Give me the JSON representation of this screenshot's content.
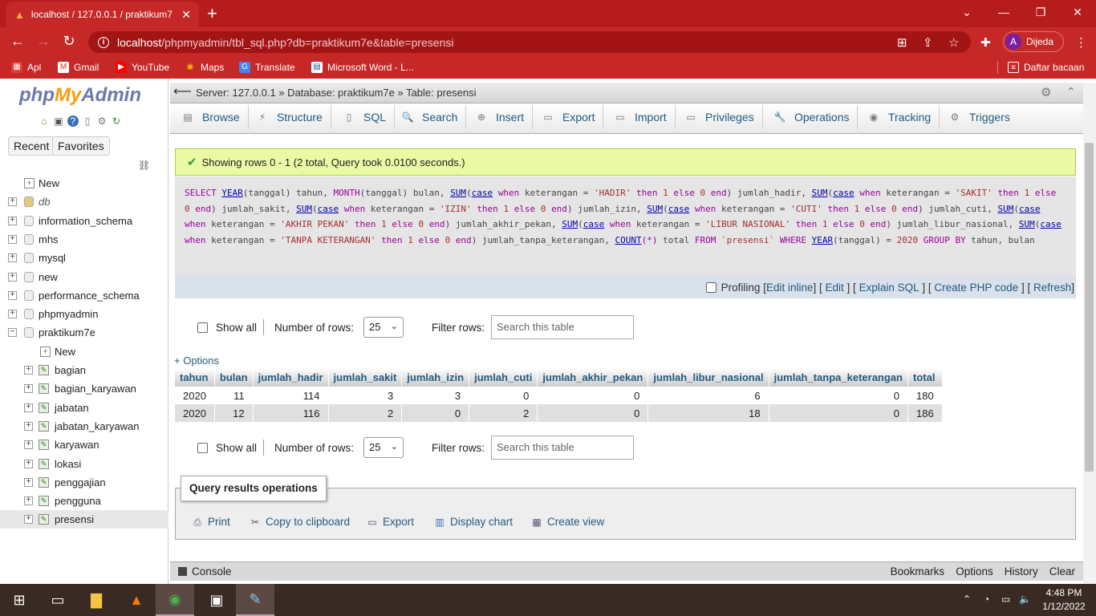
{
  "browser": {
    "tab_title": "localhost / 127.0.0.1 / praktikum7",
    "url_host": "localhost",
    "url_path": "/phpmyadmin/tbl_sql.php?db=praktikum7e&table=presensi",
    "profile_initial": "A",
    "profile_name": "Dijeda",
    "bookmarks": [
      "Apl",
      "Gmail",
      "YouTube",
      "Maps",
      "Translate",
      "Microsoft Word - L..."
    ],
    "reading_list": "Daftar bacaan"
  },
  "sidebar": {
    "logo_php": "php",
    "logo_my": "My",
    "logo_admin": "Admin",
    "recent": "Recent",
    "favorites": "Favorites",
    "tree": [
      {
        "label": "New",
        "kind": "new",
        "level": 0
      },
      {
        "label": "db",
        "kind": "db-italic",
        "level": 0
      },
      {
        "label": "information_schema",
        "kind": "db",
        "level": 0
      },
      {
        "label": "mhs",
        "kind": "db",
        "level": 0
      },
      {
        "label": "mysql",
        "kind": "db",
        "level": 0
      },
      {
        "label": "new",
        "kind": "db",
        "level": 0
      },
      {
        "label": "performance_schema",
        "kind": "db",
        "level": 0
      },
      {
        "label": "phpmyadmin",
        "kind": "db",
        "level": 0
      },
      {
        "label": "praktikum7e",
        "kind": "db-open",
        "level": 0
      },
      {
        "label": "New",
        "kind": "new",
        "level": 1
      },
      {
        "label": "bagian",
        "kind": "table",
        "level": 1
      },
      {
        "label": "bagian_karyawan",
        "kind": "table",
        "level": 1
      },
      {
        "label": "jabatan",
        "kind": "table",
        "level": 1
      },
      {
        "label": "jabatan_karyawan",
        "kind": "table",
        "level": 1
      },
      {
        "label": "karyawan",
        "kind": "table",
        "level": 1
      },
      {
        "label": "lokasi",
        "kind": "table",
        "level": 1
      },
      {
        "label": "penggajian",
        "kind": "table",
        "level": 1
      },
      {
        "label": "pengguna",
        "kind": "table",
        "level": 1
      },
      {
        "label": "presensi",
        "kind": "table",
        "level": 1
      }
    ]
  },
  "breadcrumb": "Server: 127.0.0.1 » Database: praktikum7e » Table: presensi",
  "tabs": [
    "Browse",
    "Structure",
    "SQL",
    "Search",
    "Insert",
    "Export",
    "Import",
    "Privileges",
    "Operations",
    "Tracking",
    "Triggers"
  ],
  "success_message": "Showing rows 0 - 1 (2 total, Query took 0.0100 seconds.)",
  "sql": {
    "kw_select": "SELECT",
    "fn_year": "YEAR",
    "p1": "(tanggal) tahun, ",
    "kw_month": "MONTH",
    "p2": "(tanggal) bulan, ",
    "fn_sum": "SUM",
    "kw_case": "case",
    "kw_when": "when",
    "col_ket": " keterangan = ",
    "kw_then": "then",
    "kw_else": "else",
    "kw_end": "end",
    "s_hadir": "'HADIR'",
    "a_hadir": " jumlah_hadir, ",
    "s_sakit": "'SAKIT'",
    "a_sakit": " jumlah_sakit, ",
    "s_izin": "'IZIN'",
    "a_izin": " jumlah_izin, ",
    "s_cuti": "'CUTI'",
    "a_cuti": " jumlah_cuti, ",
    "s_akhir": "'AKHIR PEKAN'",
    "a_akhir": " jumlah_akhir_pekan, ",
    "s_libur": "'LIBUR NASIONAL'",
    "a_libur": " jumlah_libur_nasional, ",
    "s_tanpa": "'TANPA KETERANGAN'",
    "a_tanpa": " jumlah_tanpa_keterangan, ",
    "fn_count": "COUNT",
    "star": "(*)",
    "a_total": " total ",
    "kw_from": "FROM",
    "tbl": " `presensi`",
    "kw_where": "WHERE",
    "p3": "(tanggal) = ",
    "n2020": "2020",
    "kw_group": "GROUP BY",
    "grp": " tahun, bulan",
    "one": "1",
    "zero": "0"
  },
  "sql_actions": {
    "profiling": "Profiling",
    "edit_inline": "Edit inline",
    "edit": "Edit",
    "explain": "Explain SQL",
    "create_php": "Create PHP code",
    "refresh": "Refresh"
  },
  "nav": {
    "show_all": "Show all",
    "number_of_rows": "Number of rows:",
    "rows_value": "25",
    "filter_rows": "Filter rows:",
    "search_placeholder": "Search this table"
  },
  "options_link": "+ Options",
  "results": {
    "columns": [
      "tahun",
      "bulan",
      "jumlah_hadir",
      "jumlah_sakit",
      "jumlah_izin",
      "jumlah_cuti",
      "jumlah_akhir_pekan",
      "jumlah_libur_nasional",
      "jumlah_tanpa_keterangan",
      "total"
    ],
    "rows": [
      [
        "2020",
        "11",
        "114",
        "3",
        "3",
        "0",
        "0",
        "6",
        "0",
        "180"
      ],
      [
        "2020",
        "12",
        "116",
        "2",
        "0",
        "2",
        "0",
        "18",
        "0",
        "186"
      ]
    ]
  },
  "query_ops": {
    "title": "Query results operations",
    "print": "Print",
    "copy": "Copy to clipboard",
    "export": "Export",
    "chart": "Display chart",
    "view": "Create view"
  },
  "console": {
    "label": "Console",
    "links": [
      "Bookmarks",
      "Options",
      "History",
      "Clear"
    ]
  },
  "taskbar": {
    "time": "4:48 PM",
    "date": "1/12/2022"
  }
}
